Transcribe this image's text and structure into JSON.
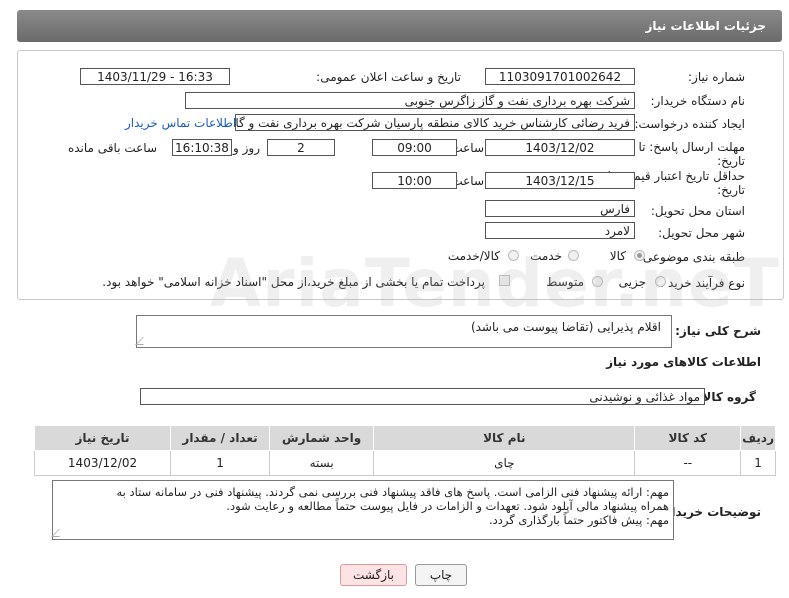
{
  "header": {
    "title": "جزئیات اطلاعات نیاز"
  },
  "form": {
    "need_number_label": "شماره نیاز:",
    "need_number": "1103091701002642",
    "announce_label": "تاریخ و ساعت اعلان عمومی:",
    "announce_value": "1403/11/29 - 16:33",
    "buyer_org_label": "نام دستگاه خریدار:",
    "buyer_org": "شرکت بهره برداری نفت و گاز زاگرس جنوبی",
    "creator_label": "ایجاد کننده درخواست:",
    "creator": "فرید رضائی کارشناس خرید کالای منطقه پارسیان شرکت بهره برداری نفت و گاز",
    "contact_link": "اطلاعات تماس خریدار",
    "deadline_label_1": "مهلت ارسال پاسخ: تا",
    "deadline_label_2": "تاریخ:",
    "deadline_date": "1403/12/02",
    "time_label": "ساعت",
    "deadline_time": "09:00",
    "days_value": "2",
    "days_label": "روز و",
    "remaining_time": "16:10:38",
    "remaining_label": "ساعت باقی مانده",
    "validity_label_1": "حداقل تاریخ اعتبار قیمت: تا",
    "validity_label_2": "تاریخ:",
    "validity_date": "1403/12/15",
    "validity_time": "10:00",
    "province_label": "استان محل تحویل:",
    "province": "فارس",
    "city_label": "شهر محل تحویل:",
    "city": "لامرد",
    "category_label": "طبقه بندی موضوعی:",
    "category_options": [
      "کالا",
      "خدمت",
      "کالا/خدمت"
    ],
    "process_label": "نوع فرآیند خرید :",
    "process_options": [
      "جزیی",
      "متوسط"
    ],
    "payment_note": "پرداخت تمام یا بخشی از مبلغ خرید،از محل \"اسناد خزانه اسلامی\" خواهد بود."
  },
  "description": {
    "label": "شرح کلی نیاز:",
    "value": "اقلام پذیرایی (تقاضا پیوست می باشد)"
  },
  "goods_section_title": "اطلاعات کالاهای مورد نیاز",
  "goods_group": {
    "label": "گروه کالا:",
    "value": "مواد غذائی و نوشیدنی"
  },
  "table": {
    "headers": [
      "ردیف",
      "کد کالا",
      "نام کالا",
      "واحد شمارش",
      "تعداد / مقدار",
      "تاریخ نیاز"
    ],
    "rows": [
      [
        "1",
        "--",
        "چای",
        "بسته",
        "1",
        "1403/12/02"
      ]
    ]
  },
  "buyer_notes": {
    "label": "توضیحات خریدار:",
    "lines": [
      "مهم: ارائه پیشنهاد فنی الزامی است. پاسخ های فاقد پیشنهاد فنی بررسی نمی گردند. پیشنهاد فنی در سامانه ستاد به",
      "همراه پیشنهاد مالی آپلود شود. تعهدات و الزامات در فایل پیوست حتماً مطالعه و رعایت شود.",
      "مهم: پیش فاکتور حتماً بارگذاری گردد."
    ]
  },
  "buttons": {
    "print": "چاپ",
    "back": "بازگشت"
  },
  "watermark": "AriaTender.neT"
}
